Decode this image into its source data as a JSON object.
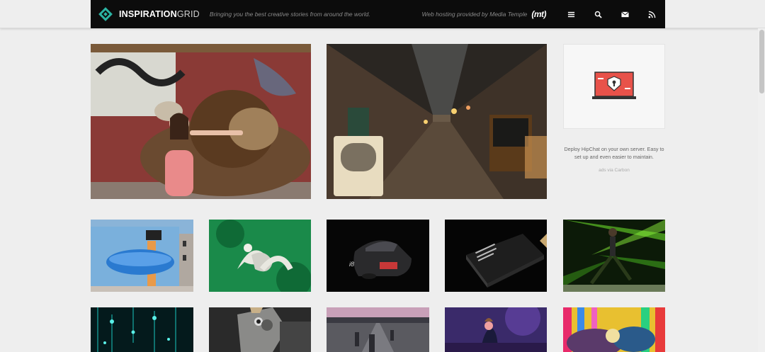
{
  "header": {
    "logo_bold": "INSPIRATION",
    "logo_light": "GRID",
    "tagline": "Bringing you the best creative stories from around the world.",
    "hosting_text": "Web hosting provided by Media Temple",
    "hosting_logo": "(mt)",
    "icons": [
      "menu-icon",
      "search-icon",
      "mail-icon",
      "rss-icon"
    ]
  },
  "featured": [
    {
      "name": "featured-lion-girl",
      "subject": "girl with lion graffiti"
    },
    {
      "name": "featured-alley-street",
      "subject": "night alley street"
    }
  ],
  "ad": {
    "text": "Deploy HipChat on your own server. Easy to set up and even easier to maintain.",
    "via": "ads via Carbon"
  },
  "grid_row_1": [
    "whale-mural",
    "green-3d-type",
    "black-car",
    "black-book",
    "neon-dancer"
  ],
  "grid_row_2": [
    "teal-lights",
    "robot-head",
    "road-scene",
    "purple-illustration",
    "colorful-abstract"
  ],
  "colors": {
    "topbar": "#0c0c0c",
    "background": "#eeeeee",
    "accent": "#2bb3a3",
    "ad_red": "#e8524a"
  }
}
